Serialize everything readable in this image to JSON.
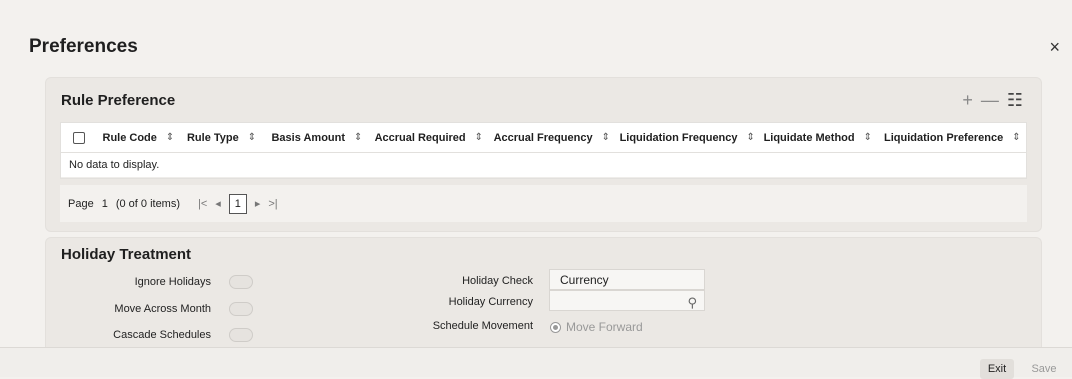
{
  "page": {
    "title": "Preferences",
    "close_label": "×"
  },
  "rule_preference": {
    "title": "Rule Preference",
    "toolbar": {
      "add": "+",
      "remove": "—",
      "columns": "☷"
    },
    "columns": [
      "Rule Code",
      "Rule Type",
      "Basis Amount",
      "Accrual Required",
      "Accrual Frequency",
      "Liquidation Frequency",
      "Liquidate Method",
      "Liquidation Preference"
    ],
    "empty_text": "No data to display.",
    "pager": {
      "page_label": "Page",
      "page_value": "1",
      "items_text": "(0 of 0 items)",
      "first": "|<",
      "prev": "◂",
      "current": "1",
      "next": "▸",
      "last": ">|"
    }
  },
  "holiday_treatment": {
    "title": "Holiday Treatment",
    "ignore_holidays": "Ignore Holidays",
    "move_across_month": "Move Across Month",
    "cascade_schedules": "Cascade Schedules",
    "holiday_check_label": "Holiday Check",
    "holiday_check_value": "Currency",
    "holiday_currency_label": "Holiday Currency",
    "holiday_currency_value": "",
    "schedule_movement_label": "Schedule Movement",
    "schedule_movement_option": "Move Forward"
  },
  "footer": {
    "exit": "Exit",
    "save": "Save"
  }
}
